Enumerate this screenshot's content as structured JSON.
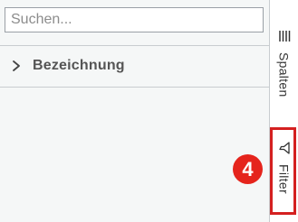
{
  "search": {
    "placeholder": "Suchen...",
    "value": ""
  },
  "groups": [
    {
      "label": "Bezeichnung",
      "expanded": false
    }
  ],
  "side_tabs": {
    "columns": {
      "label": "Spalten",
      "icon": "columns-icon"
    },
    "filter": {
      "label": "Filter",
      "icon": "filter-icon"
    }
  },
  "annotation": {
    "badge_number": "4",
    "color": "#e5241c"
  }
}
